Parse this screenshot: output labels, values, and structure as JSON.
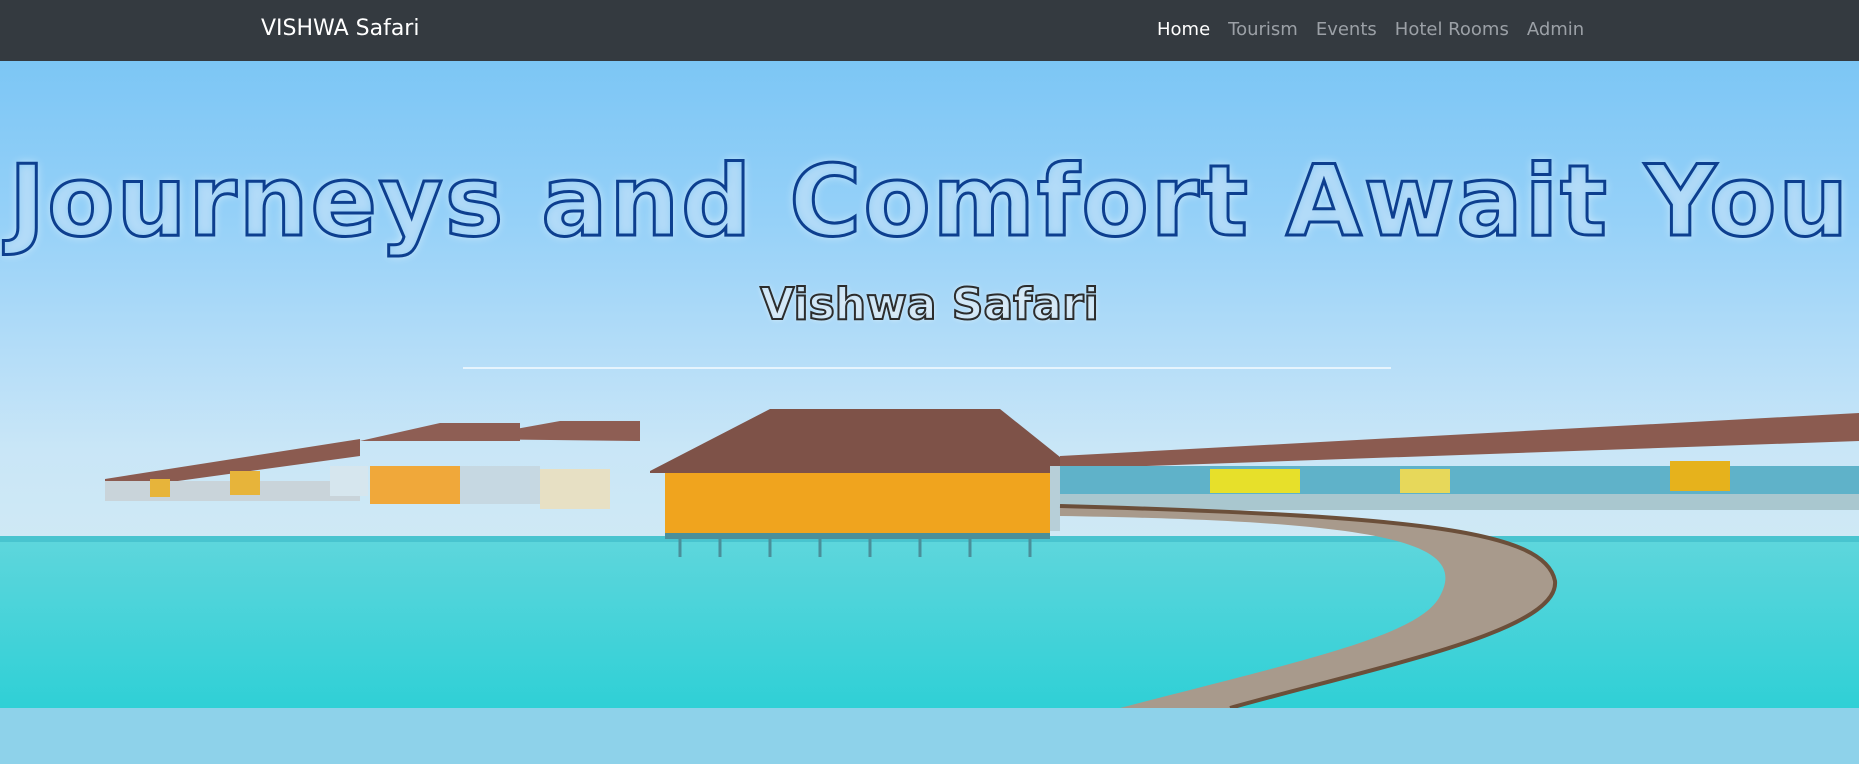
{
  "navbar": {
    "brand": "VISHWA Safari",
    "links": [
      {
        "label": "Home",
        "active": true
      },
      {
        "label": "Tourism",
        "active": false
      },
      {
        "label": "Events",
        "active": false
      },
      {
        "label": "Hotel Rooms",
        "active": false
      },
      {
        "label": "Admin",
        "active": false
      }
    ]
  },
  "hero": {
    "headline": "Journeys and Comfort Await You",
    "subheadline": "Vishwa Safari"
  },
  "colors": {
    "navbar_bg": "#343a40",
    "nav_active": "#ffffff",
    "nav_inactive": "#9ba0a6",
    "headline_stroke": "#0d3f8f",
    "footer_band": "#8ed2ea"
  }
}
